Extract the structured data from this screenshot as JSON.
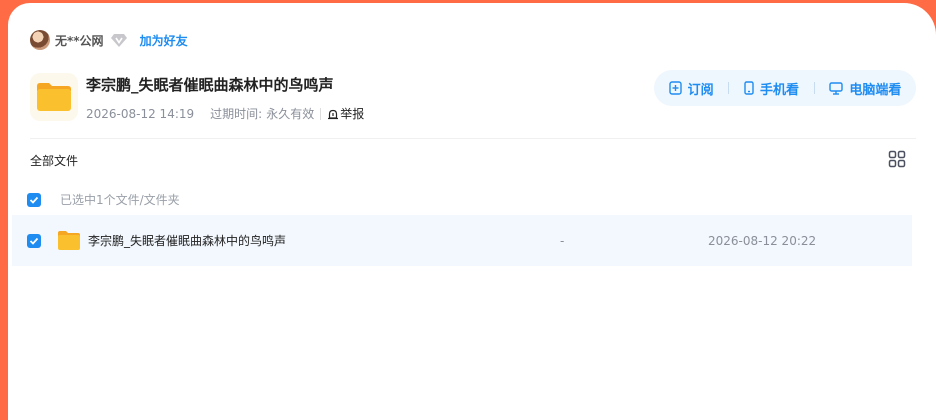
{
  "user": {
    "name": "无**公网",
    "add_friend": "加为好友"
  },
  "share": {
    "title": "李宗鹏_失眠者催眠曲森林中的鸟鸣声",
    "created": "2026-08-12 14:19",
    "expire_label": "过期时间:",
    "expire_value": "永久有效",
    "report": "举报"
  },
  "actions": {
    "subscribe": "订阅",
    "mobile": "手机看",
    "pc": "电脑端看"
  },
  "breadcrumb": "全部文件",
  "selection_text": "已选中1个文件/文件夹",
  "files": [
    {
      "name": "李宗鹏_失眠者催眠曲森林中的鸟鸣声",
      "size": "-",
      "date": "2026-08-12 20:22"
    }
  ],
  "colors": {
    "background": "#ff6b45",
    "accent": "#1e8cf0",
    "row_highlight": "#f2f8fe",
    "folder": "#fbc02d"
  }
}
